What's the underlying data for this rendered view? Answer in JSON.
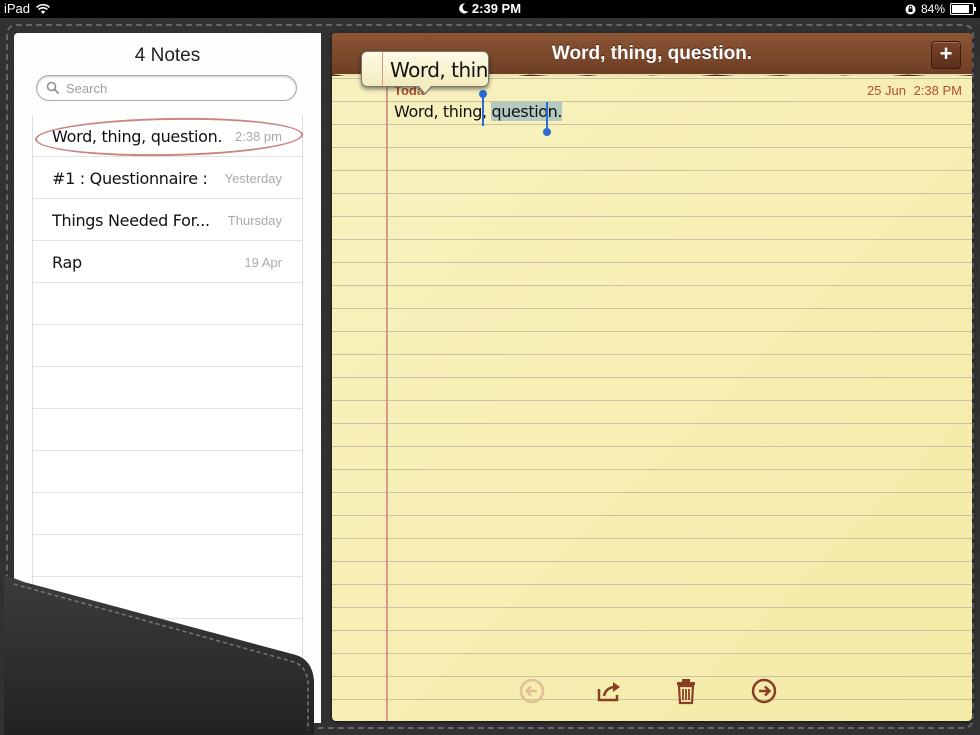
{
  "status_bar": {
    "device": "iPad",
    "time": "2:39 PM",
    "battery": "84%",
    "battery_level": 0.84
  },
  "sidebar": {
    "title": "4 Notes",
    "search_placeholder": "Search",
    "notes": [
      {
        "title": "Word, thing, question.",
        "date": "2:38 pm",
        "selected": true
      },
      {
        "title": "#1 : Questionnaire :",
        "date": "Yesterday",
        "selected": false
      },
      {
        "title": "Things Needed For...",
        "date": "Thursday",
        "selected": false
      },
      {
        "title": "Rap",
        "date": "19 Apr",
        "selected": false
      }
    ]
  },
  "note": {
    "header_title": "Word, thing, question.",
    "add_label": "+",
    "meta_day": "Toda",
    "meta_date": "25 Jun",
    "meta_time": "2:38 PM",
    "body_prefix": "Word, thing, ",
    "body_selected": "question.",
    "magnifier_text": "Word, thing"
  },
  "toolbar": {
    "icons": [
      "back-arrow-icon",
      "share-icon",
      "trash-icon",
      "forward-arrow-icon"
    ]
  },
  "colors": {
    "header_brown": "#7a4529",
    "paper": "#f6eeb3",
    "selection": "#b4c9c0",
    "handle": "#2a6bd8",
    "meta_text": "#b04f32"
  }
}
